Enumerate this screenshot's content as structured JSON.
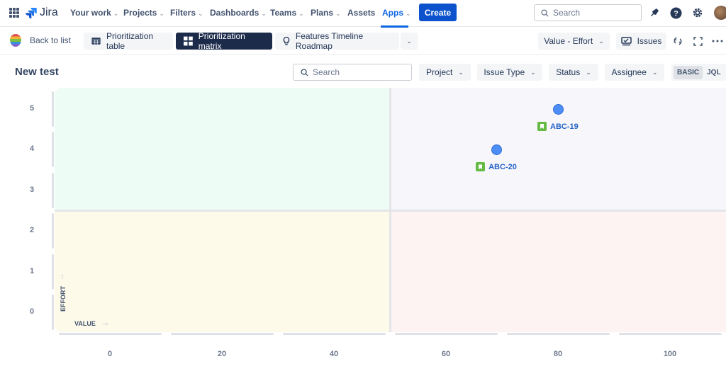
{
  "app": {
    "name": "Jira"
  },
  "topnav": {
    "items": [
      {
        "label": "Your work",
        "dropdown": true
      },
      {
        "label": "Projects",
        "dropdown": true
      },
      {
        "label": "Filters",
        "dropdown": true
      },
      {
        "label": "Dashboards",
        "dropdown": true
      },
      {
        "label": "Teams",
        "dropdown": true
      },
      {
        "label": "Plans",
        "dropdown": true
      },
      {
        "label": "Assets",
        "dropdown": false
      },
      {
        "label": "Apps",
        "dropdown": true,
        "active": true
      }
    ],
    "create_label": "Create",
    "search_placeholder": "Search",
    "icons": [
      "app-switcher-icon",
      "notifications-icon",
      "help-icon",
      "settings-icon",
      "profile-avatar"
    ]
  },
  "subbar": {
    "back_label": "Back to list",
    "tabs": [
      {
        "label": "Prioritization table",
        "icon": "table-icon",
        "selected": false
      },
      {
        "label": "Prioritization matrix",
        "icon": "matrix-icon",
        "selected": true
      },
      {
        "label": "Features Timeline Roadmap",
        "icon": "lightbulb-icon",
        "selected": false
      }
    ],
    "matrix_select": "Value - Effort",
    "issues_label": "Issues"
  },
  "page": {
    "title": "New test",
    "search_placeholder": "Search",
    "filters": [
      "Project",
      "Issue Type",
      "Status",
      "Assignee"
    ],
    "mode_toggle": {
      "basic": "BASIC",
      "jql": "JQL",
      "selected": "BASIC"
    }
  },
  "chart_data": {
    "type": "scatter",
    "xlabel": "VALUE",
    "ylabel": "EFFORT",
    "x_ticks": [
      "0",
      "20",
      "40",
      "60",
      "80",
      "100"
    ],
    "y_ticks": [
      "5",
      "4",
      "3",
      "2",
      "1",
      "0"
    ],
    "xlim": [
      0,
      100
    ],
    "ylim": [
      0,
      5
    ],
    "quadrants": [
      {
        "name": "top-left",
        "color": "#edfcf5"
      },
      {
        "name": "top-right",
        "color": "#f6f6fb"
      },
      {
        "name": "bottom-left",
        "color": "#fdfaea"
      },
      {
        "name": "bottom-right",
        "color": "#fdf3f3"
      }
    ],
    "points": [
      {
        "key": "ABC-19",
        "value": 80,
        "effort": 5,
        "issue_type": "story"
      },
      {
        "key": "ABC-20",
        "value": 69,
        "effort": 4,
        "issue_type": "story"
      }
    ]
  }
}
